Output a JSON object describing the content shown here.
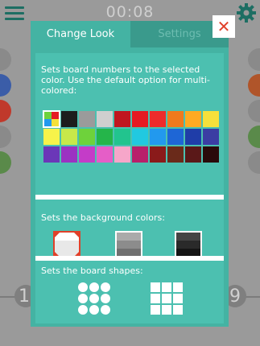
{
  "header": {
    "timer": "00:08"
  },
  "background_board": {
    "left_number": "1",
    "right_number": "9"
  },
  "dialog": {
    "tabs": [
      {
        "label": "Change Look",
        "active": true
      },
      {
        "label": "Settings",
        "active": false
      }
    ],
    "close_label": "✕",
    "number_color_section": {
      "description": "Sets board numbers to the selected color. Use the default option for multi-colored:",
      "swatches": [
        "multi",
        "#1d1d1d",
        "#9b9b9b",
        "#cfcfcf",
        "#c0161f",
        "#e51a23",
        "#ee2b2b",
        "#f07a1d",
        "#ffaa22",
        "#f6e03b",
        "#f7f34a",
        "#c7e84a",
        "#6ed23b",
        "#25b54a",
        "#22c48e",
        "#21c9e0",
        "#2299ee",
        "#1e66d6",
        "#1f3da8",
        "#3b3da3",
        "#6b37b8",
        "#9b32c2",
        "#c43cc8",
        "#e55ec7",
        "#f6a6c9",
        "#b81f6a",
        "#8a1a1a",
        "#6a2a1a",
        "#5a1818",
        "#2a0a0a"
      ],
      "selected_index": 0
    },
    "background_section": {
      "description": "Sets the background colors:",
      "options": [
        {
          "name": "light",
          "selected": true
        },
        {
          "name": "gray",
          "selected": false
        },
        {
          "name": "dark",
          "selected": false
        }
      ]
    },
    "shape_section": {
      "description": "Sets the board shapes:",
      "options": [
        {
          "name": "circles",
          "selected": true
        },
        {
          "name": "squares",
          "selected": false
        }
      ]
    }
  },
  "colors": {
    "accent": "#44b3a3",
    "section": "#4cc0b0",
    "close_x": "#e0412a"
  }
}
